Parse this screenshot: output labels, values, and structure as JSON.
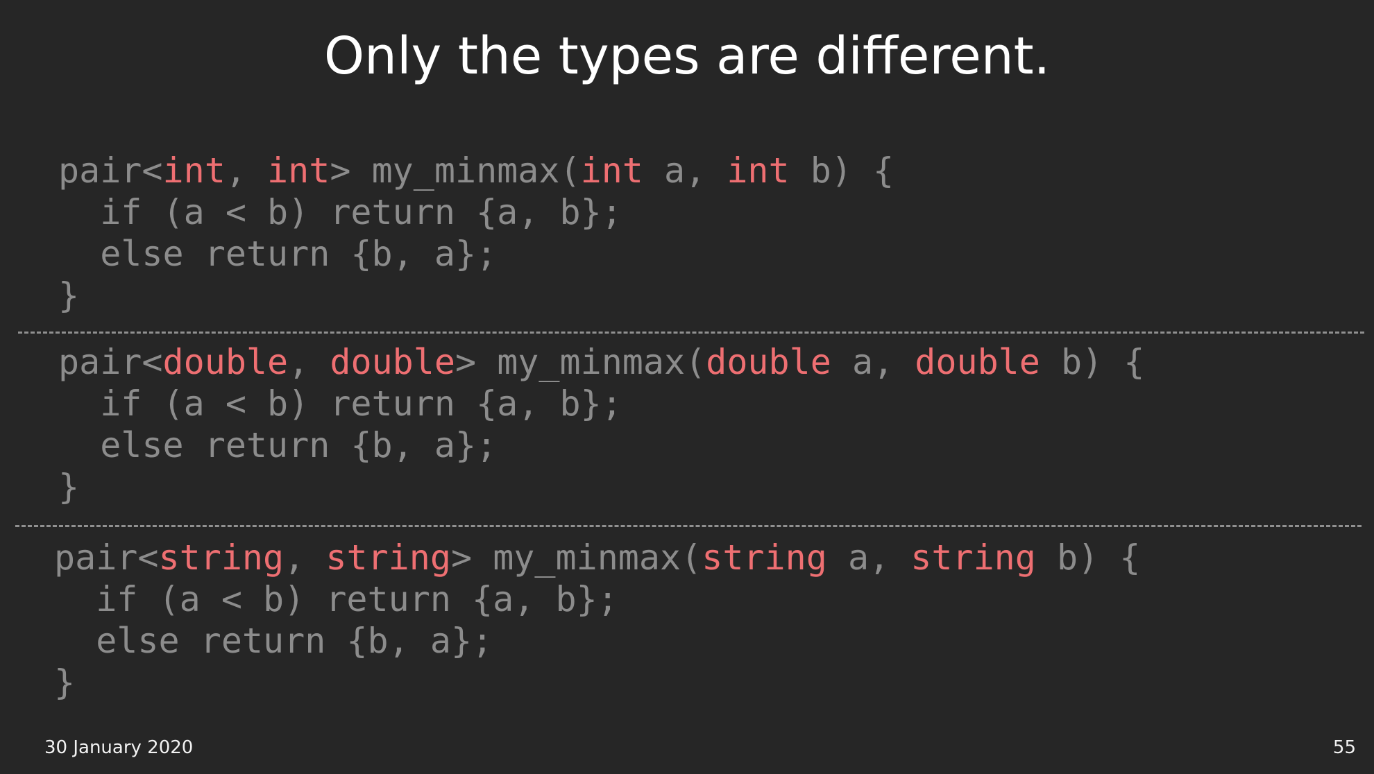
{
  "slide": {
    "title": "Only the types are different.",
    "footer": {
      "date": "30 January 2020",
      "page_number": "55"
    }
  },
  "code_blocks": [
    {
      "signature": {
        "t1": "pair<",
        "type1": "int",
        "t2": ", ",
        "type2": "int",
        "t3": "> my_minmax(",
        "type3": "int",
        "t4": " a, ",
        "type4": "int",
        "t5": " b) {"
      },
      "line_if": "  if (a < b) return {a, b};",
      "line_else": "  else return {b, a};",
      "line_close": "}"
    },
    {
      "signature": {
        "t1": "pair<",
        "type1": "double",
        "t2": ", ",
        "type2": "double",
        "t3": "> my_minmax(",
        "type3": "double",
        "t4": " a, ",
        "type4": "double",
        "t5": " b) {"
      },
      "line_if": "  if (a < b) return {a, b};",
      "line_else": "  else return {b, a};",
      "line_close": "}"
    },
    {
      "signature": {
        "t1": "pair<",
        "type1": "string",
        "t2": ", ",
        "type2": "string",
        "t3": "> my_minmax(",
        "type3": "string",
        "t4": " a, ",
        "type4": "string",
        "t5": " b) {"
      },
      "line_if": "  if (a < b) return {a, b};",
      "line_else": "  else return {b, a};",
      "line_close": "}"
    }
  ],
  "colors": {
    "background": "#262626",
    "title_text": "#ffffff",
    "code_text": "#8c8c8c",
    "type_keyword": "#ee6f72",
    "divider": "#909090"
  }
}
